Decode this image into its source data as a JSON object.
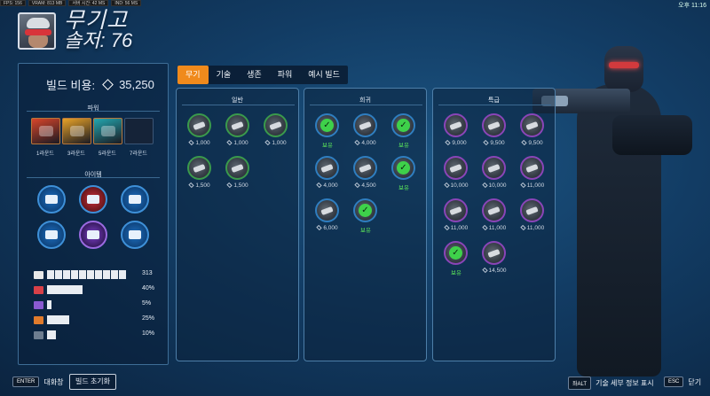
{
  "debug": {
    "fps": "FPS: 156",
    "vram": "VRAM: 813 MB",
    "server": "서버 시간: 42 MS",
    "ind": "IND: 56 MS"
  },
  "clock": "오후 11:16",
  "hero": {
    "title": "무기고",
    "subtitle": "솔저: 76"
  },
  "build_cost": {
    "label": "빌드 비용:",
    "value": "35,250",
    "icon": "gem-icon"
  },
  "powers": {
    "label": "파워",
    "slots": [
      {
        "round": "1라운드",
        "color": "#d8452a",
        "filled": true
      },
      {
        "round": "3라운드",
        "color": "#e7a228",
        "filled": true
      },
      {
        "round": "5라운드",
        "color": "#24a7b0",
        "filled": true
      },
      {
        "round": "7라운드",
        "color": "#152338",
        "filled": false
      }
    ]
  },
  "items": {
    "label": "아이템",
    "slots": [
      {
        "name": "item-1",
        "style": "blue"
      },
      {
        "name": "item-2",
        "style": "red"
      },
      {
        "name": "item-3",
        "style": "blue"
      },
      {
        "name": "item-4",
        "style": "blue"
      },
      {
        "name": "item-5",
        "style": "purple"
      },
      {
        "name": "item-6",
        "style": "blue"
      }
    ]
  },
  "stats": [
    {
      "name": "health",
      "value": "313",
      "fill": 1.0,
      "color": "#e8e8e8",
      "segmented": true
    },
    {
      "name": "weapon-power",
      "value": "40%",
      "fill": 0.4,
      "color": "#d84048",
      "segmented": false
    },
    {
      "name": "ability-power",
      "value": "5%",
      "fill": 0.05,
      "color": "#8a5ad0",
      "segmented": false
    },
    {
      "name": "attack-speed",
      "value": "25%",
      "fill": 0.25,
      "color": "#e07b2c",
      "segmented": false
    },
    {
      "name": "cooldown",
      "value": "10%",
      "fill": 0.1,
      "color": "#6d7d90",
      "segmented": false
    }
  ],
  "tabs": [
    {
      "label": "무기",
      "active": true
    },
    {
      "label": "기술",
      "active": false
    },
    {
      "label": "생존",
      "active": false
    },
    {
      "label": "파워",
      "active": false
    },
    {
      "label": "예시 빌드",
      "active": false
    }
  ],
  "columns": [
    {
      "title": "일반",
      "border": "#3a9a4c",
      "items": [
        {
          "price": "1,000",
          "owned": false
        },
        {
          "price": "1,000",
          "owned": false
        },
        {
          "price": "1,000",
          "owned": false
        },
        {
          "price": "1,500",
          "owned": false
        },
        {
          "price": "1,500",
          "owned": false
        }
      ]
    },
    {
      "title": "희귀",
      "border": "#2f7ec0",
      "items": [
        {
          "price": "보유",
          "owned": true
        },
        {
          "price": "4,000",
          "owned": false
        },
        {
          "price": "보유",
          "owned": true
        },
        {
          "price": "4,000",
          "owned": false
        },
        {
          "price": "4,500",
          "owned": false
        },
        {
          "price": "보유",
          "owned": true
        },
        {
          "price": "6,000",
          "owned": false
        },
        {
          "price": "보유",
          "owned": true
        }
      ]
    },
    {
      "title": "특급",
      "border": "#8a45b8",
      "items": [
        {
          "price": "9,000",
          "owned": false
        },
        {
          "price": "9,500",
          "owned": false
        },
        {
          "price": "9,500",
          "owned": false
        },
        {
          "price": "10,000",
          "owned": false
        },
        {
          "price": "10,000",
          "owned": false
        },
        {
          "price": "11,000",
          "owned": false
        },
        {
          "price": "11,000",
          "owned": false
        },
        {
          "price": "11,000",
          "owned": false
        },
        {
          "price": "11,000",
          "owned": false
        },
        {
          "price": "보유",
          "owned": true
        },
        {
          "price": "14,500",
          "owned": false
        }
      ]
    }
  ],
  "footer": {
    "chat_key": "ENTER",
    "chat_label": "대화창",
    "reset_label": "빌드 초기화",
    "detail_key": "좌ALT",
    "detail_label": "기술 세부 정보 표시",
    "close_key": "ESC",
    "close_label": "닫기"
  }
}
